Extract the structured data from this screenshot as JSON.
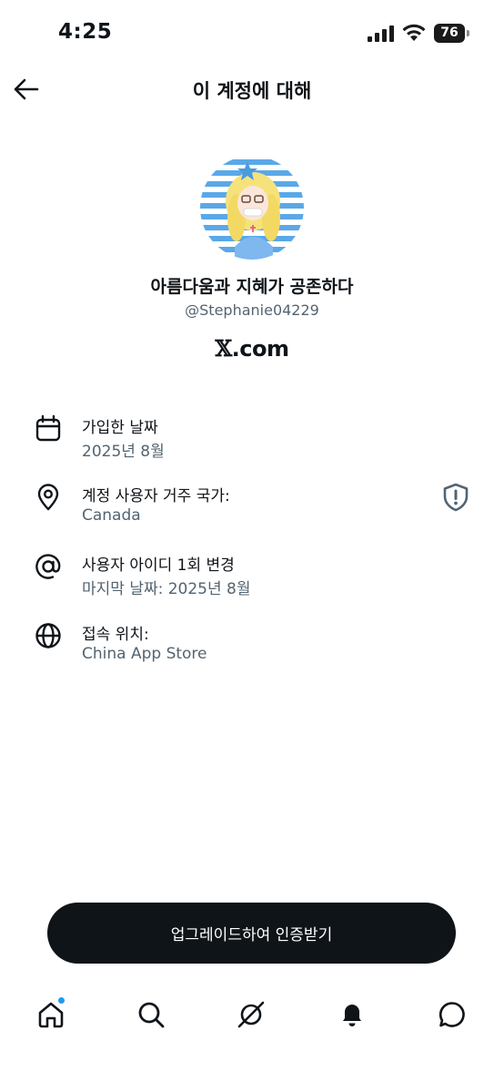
{
  "status_bar": {
    "time": "4:25",
    "battery": "76"
  },
  "header": {
    "title": "이 계정에 대해"
  },
  "profile": {
    "display_name": "아름다움과 지혜가 공존하다",
    "handle": "@Stephanie04229",
    "brand_x": "𝕏",
    "brand_suffix": ".com"
  },
  "info": [
    {
      "icon": "calendar-icon",
      "title": "가입한 날짜",
      "value": "2025년 8월"
    },
    {
      "icon": "location-pin-icon",
      "title": "계정 사용자 거주 국가:",
      "value": "Canada",
      "badge": "shield-exclamation-icon"
    },
    {
      "icon": "at-sign-icon",
      "title": "사용자 아이디 1회 변경",
      "value": "마지막 날짜: 2025년 8월"
    },
    {
      "icon": "globe-icon",
      "title": "접속 위치:",
      "value": "China App Store"
    }
  ],
  "cta": {
    "label": "업그레이드하여 인증받기"
  },
  "tabbar": {
    "items": [
      "home-icon",
      "search-icon",
      "grok-icon",
      "notifications-icon",
      "messages-icon"
    ],
    "notification_dot_color": "#1d9bf0"
  },
  "colors": {
    "primary_text": "#0f1419",
    "secondary_text": "#536471",
    "accent": "#1d9bf0",
    "cta_bg": "#0f1419"
  }
}
